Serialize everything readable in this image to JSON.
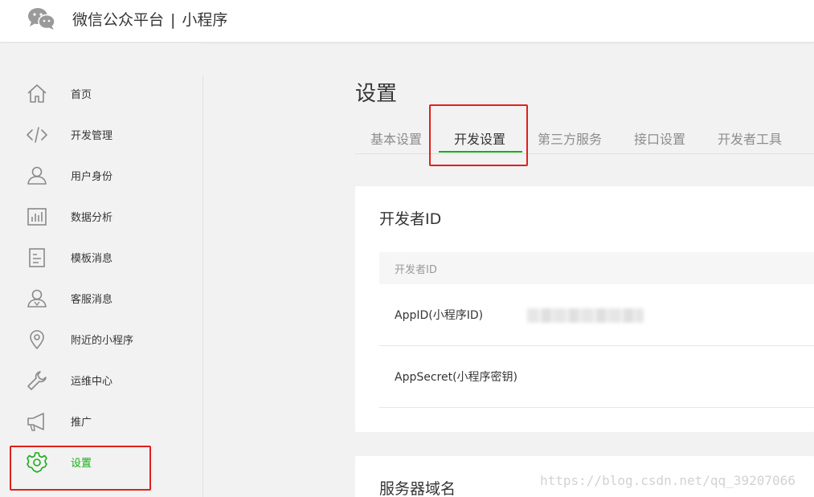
{
  "header": {
    "brand": "微信公众平台",
    "separator": "|",
    "product": "小程序"
  },
  "sidebar": {
    "items": [
      {
        "label": "首页",
        "icon": "home-icon"
      },
      {
        "label": "开发管理",
        "icon": "code-icon"
      },
      {
        "label": "用户身份",
        "icon": "user-icon"
      },
      {
        "label": "数据分析",
        "icon": "chart-icon"
      },
      {
        "label": "模板消息",
        "icon": "document-icon"
      },
      {
        "label": "客服消息",
        "icon": "customer-service-icon"
      },
      {
        "label": "附近的小程序",
        "icon": "location-pin-icon"
      },
      {
        "label": "运维中心",
        "icon": "wrench-icon"
      },
      {
        "label": "推广",
        "icon": "megaphone-icon"
      },
      {
        "label": "设置",
        "icon": "gear-icon",
        "active": true
      }
    ]
  },
  "main": {
    "title": "设置",
    "tabs": [
      {
        "label": "基本设置"
      },
      {
        "label": "开发设置",
        "active": true
      },
      {
        "label": "第三方服务"
      },
      {
        "label": "接口设置"
      },
      {
        "label": "开发者工具"
      }
    ],
    "developer_card": {
      "title": "开发者ID",
      "table_header": "开发者ID",
      "rows": [
        {
          "label": "AppID(小程序ID)",
          "value_redacted": true
        },
        {
          "label": "AppSecret(小程序密钥)"
        }
      ]
    },
    "server_card": {
      "title": "服务器域名"
    }
  },
  "watermark": "https://blog.csdn.net/qq_39207066",
  "colors": {
    "accent_green": "#1aad19",
    "highlight_red": "#e0201c",
    "background": "#f2f2f2"
  }
}
